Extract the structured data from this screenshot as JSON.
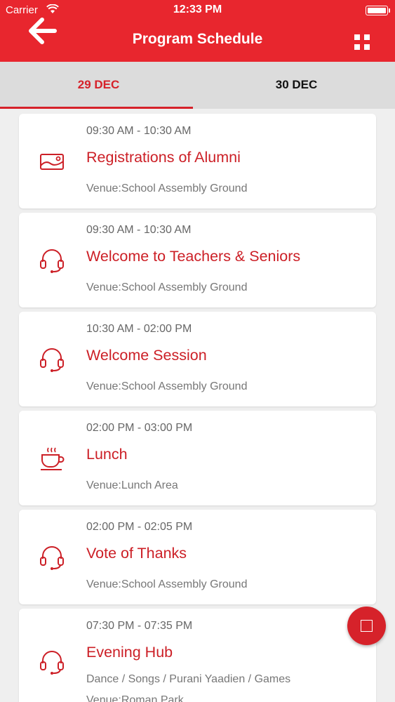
{
  "status_bar": {
    "carrier": "Carrier",
    "time": "12:33 PM"
  },
  "header": {
    "title": "Program Schedule"
  },
  "tabs": [
    {
      "label": "29 DEC",
      "active": true
    },
    {
      "label": "30 DEC",
      "active": false
    }
  ],
  "events": [
    {
      "time": "09:30 AM - 10:30 AM",
      "title": "Registrations of Alumni",
      "venue": "Venue:School Assembly Ground",
      "icon": "image-icon"
    },
    {
      "time": "09:30 AM - 10:30 AM",
      "title": "Welcome to Teachers & Seniors",
      "venue": "Venue:School Assembly Ground",
      "icon": "headset-icon"
    },
    {
      "time": "10:30 AM - 02:00 PM",
      "title": "Welcome Session",
      "venue": "Venue:School Assembly Ground",
      "icon": "headset-icon"
    },
    {
      "time": "02:00 PM - 03:00 PM",
      "title": "Lunch",
      "venue": "Venue:Lunch Area",
      "icon": "coffee-cup-icon"
    },
    {
      "time": "02:00 PM - 02:05 PM",
      "title": "Vote of Thanks",
      "venue": "Venue:School Assembly Ground",
      "icon": "headset-icon"
    },
    {
      "time": "07:30 PM - 07:35 PM",
      "title": "Evening Hub",
      "description": "Dance / Songs / Purani Yaadien / Games",
      "venue": "Venue:Roman Park",
      "icon": "headset-icon"
    }
  ],
  "colors": {
    "brand": "#e8262e",
    "accent_text": "#cc1f26",
    "tab_bar": "#dcdcdc",
    "background": "#efefef"
  }
}
